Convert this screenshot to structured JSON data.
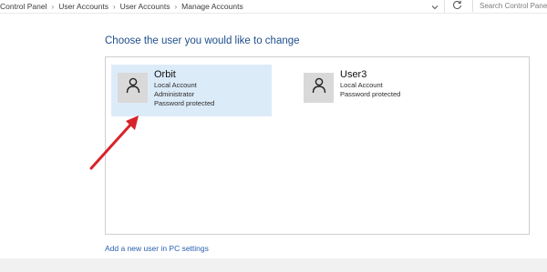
{
  "address_bar": {
    "breadcrumb": [
      "Control Panel",
      "User Accounts",
      "User Accounts",
      "Manage Accounts"
    ],
    "separator_icon": "chevron-right-icon",
    "search_placeholder": "Search Control Panel"
  },
  "main": {
    "heading": "Choose the user you would like to change",
    "accounts": [
      {
        "name": "Orbit",
        "details": [
          "Local Account",
          "Administrator",
          "Password protected"
        ],
        "avatar_icon": "user-icon",
        "selected": true
      },
      {
        "name": "User3",
        "details": [
          "Local Account",
          "Password protected"
        ],
        "avatar_icon": "user-icon",
        "selected": false
      }
    ],
    "add_user_link": "Add a new user in PC settings"
  },
  "colors": {
    "heading": "#1f4e8c",
    "selected_account_bg": "#dcebf8",
    "link": "#2a62b0",
    "annotation_arrow": "#d8232a"
  }
}
